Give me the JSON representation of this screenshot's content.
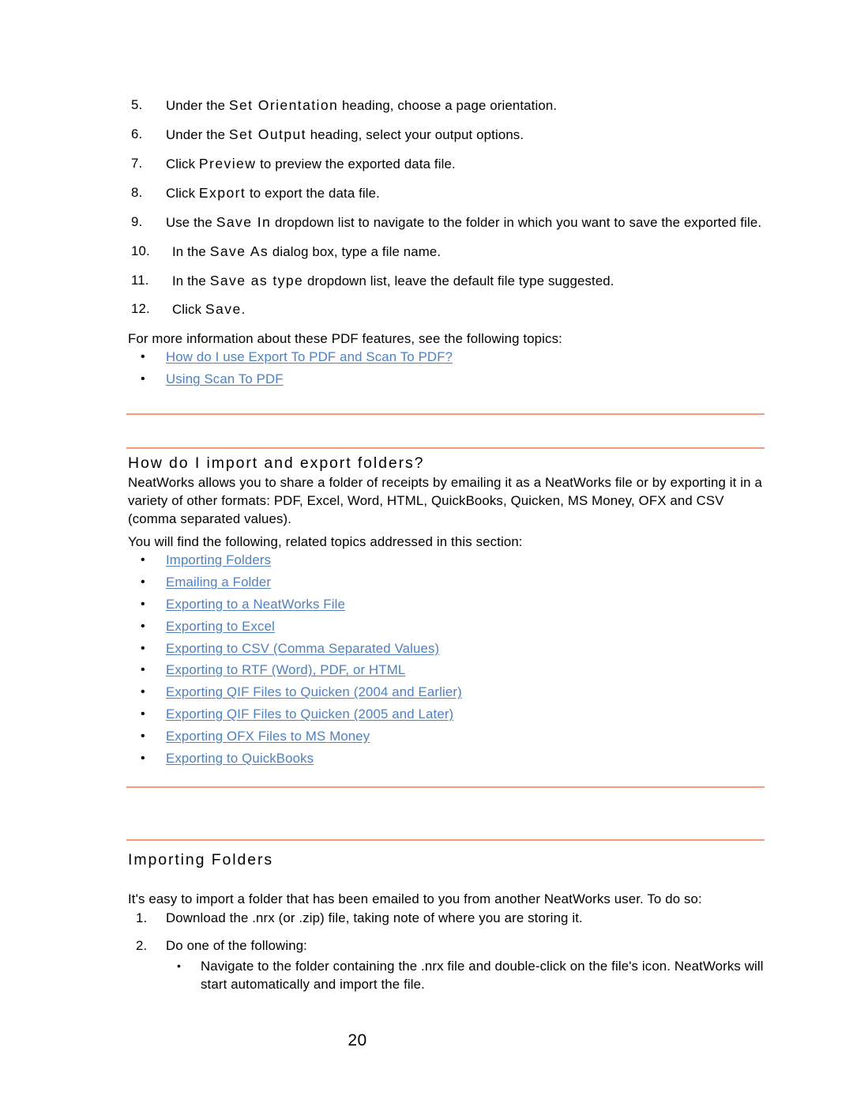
{
  "document": {
    "page_number": "20",
    "link_color": "#4F81BD",
    "rule_color": "#FA9A78"
  },
  "steps_continued": [
    {
      "number": "5.",
      "before": "Under the ",
      "term": "Set Orientation",
      "after": " heading, choose a page orientation."
    },
    {
      "number": "6.",
      "before": "Under the ",
      "term": "Set Output",
      "after": " heading, select your output options."
    },
    {
      "number": "7.",
      "before": "Click ",
      "term": "Preview",
      "after": " to preview the exported data file."
    },
    {
      "number": "8.",
      "before": "Click ",
      "term": "Export",
      "after": " to export the data file."
    },
    {
      "number": "9.",
      "before": "Use the ",
      "term": "Save In",
      "after": " dropdown list to navigate to the folder in which you want to save the exported file."
    },
    {
      "number": "10.",
      "before": "In the ",
      "term": "Save As",
      "after": " dialog box, type a file name."
    },
    {
      "number": "11.",
      "before": "In the ",
      "term": "Save as type",
      "after": " dropdown list, leave the default file type suggested."
    },
    {
      "number": "12.",
      "before": "Click ",
      "term": "Save",
      "after": "."
    }
  ],
  "pdf_topics": {
    "intro": "For more information about these PDF features, see the following topics:",
    "bullet_glyph": "•",
    "links": [
      "How do I use Export To PDF and Scan To PDF? ",
      "Using Scan To PDF "
    ]
  },
  "import_export_section": {
    "heading": "How do I import and export folders?",
    "paragraph": "NeatWorks allows you to share a folder of receipts by emailing it as a NeatWorks file or by exporting it in a variety of other formats: PDF, Excel, Word, HTML, QuickBooks, Quicken, MS Money, OFX and CSV (comma separated values).",
    "intro": "You will find the following, related topics addressed in this section:",
    "bullet_glyph": "•",
    "links": [
      "Importing Folders",
      "Emailing a Folder",
      "Exporting to a NeatWorks File",
      "Exporting to Excel",
      "Exporting to CSV (Comma Separated Values)",
      "Exporting to RTF (Word), PDF, or HTML",
      "Exporting QIF Files to Quicken (2004 and Earlier)",
      "Exporting QIF Files to Quicken (2005 and Later)",
      "Exporting OFX Files to MS Money",
      "Exporting to QuickBooks"
    ]
  },
  "importing_folders_section": {
    "heading": "Importing Folders",
    "paragraph": "It's easy to import a folder that has been emailed to you from another NeatWorks user. To do so:",
    "bullet_glyph": "•",
    "steps": [
      {
        "number": "1.",
        "text": "Download the .nrx (or .zip) file, taking note of where you are storing it."
      },
      {
        "number": "2.",
        "text": "Do one of the following:",
        "sub_bullets": [
          "Navigate to the folder containing the .nrx file and double-click on the file's icon. NeatWorks will start automatically and import the file."
        ]
      }
    ]
  }
}
